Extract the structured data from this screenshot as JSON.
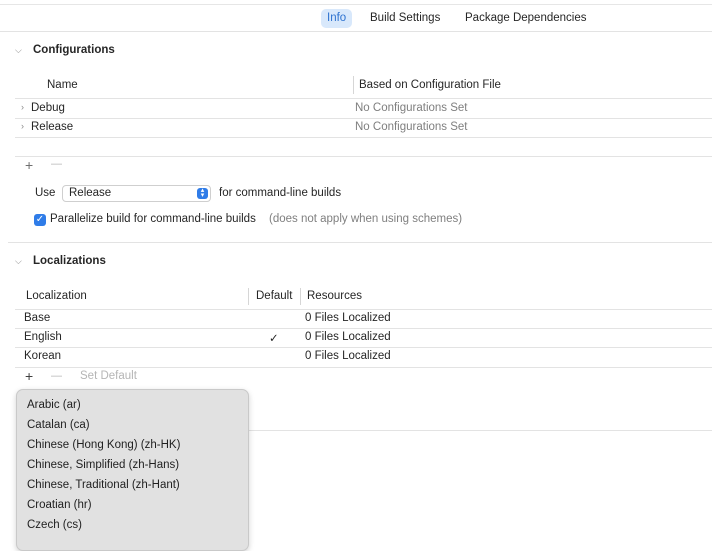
{
  "tabs": [
    {
      "label": "Info",
      "active": true
    },
    {
      "label": "Build Settings",
      "active": false
    },
    {
      "label": "Package Dependencies",
      "active": false
    }
  ],
  "configurations": {
    "title": "Configurations",
    "col_name": "Name",
    "col_based_on": "Based on Configuration File",
    "rows": [
      {
        "name": "Debug",
        "based_on": "No Configurations Set"
      },
      {
        "name": "Release",
        "based_on": "No Configurations Set"
      }
    ],
    "add_symbol": "+",
    "remove_symbol": "—",
    "use_label": "Use",
    "use_value": "Release",
    "use_suffix": "for command-line builds",
    "parallelize_label": "Parallelize build for command-line builds",
    "parallelize_note": "(does not apply when using schemes)",
    "parallelize_checked": true
  },
  "localizations": {
    "title": "Localizations",
    "col_localization": "Localization",
    "col_default": "Default",
    "col_resources": "Resources",
    "rows": [
      {
        "name": "Base",
        "default": "",
        "resources": "0 Files Localized"
      },
      {
        "name": "English",
        "default": "✓",
        "resources": "0 Files Localized"
      },
      {
        "name": "Korean",
        "default": "",
        "resources": "0 Files Localized"
      }
    ],
    "add_symbol": "+",
    "remove_symbol": "—",
    "set_default_label": "Set Default"
  },
  "language_menu": {
    "items": [
      "Arabic (ar)",
      "Catalan (ca)",
      "Chinese (Hong Kong) (zh-HK)",
      "Chinese, Simplified (zh-Hans)",
      "Chinese, Traditional (zh-Hant)",
      "Croatian (hr)",
      "Czech (cs)"
    ]
  },
  "colors": {
    "accent": "#2f7ce8",
    "tab_active_bg": "#d8e8fb",
    "menu_bg": "#e1e1e1"
  }
}
